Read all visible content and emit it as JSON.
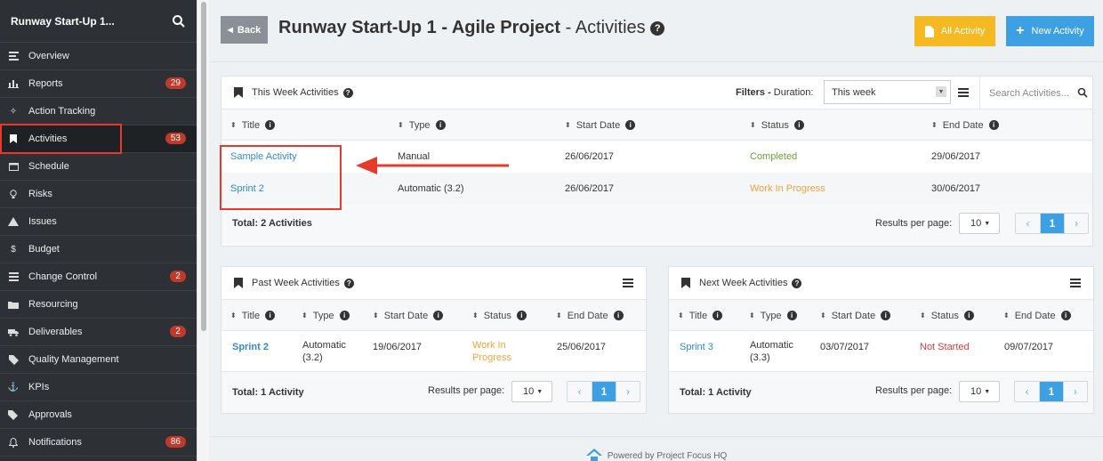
{
  "sidebar": {
    "project_name": "Runway Start-Up 1...",
    "items": [
      {
        "label": "Overview",
        "icon": "overview-icon"
      },
      {
        "label": "Reports",
        "icon": "chart-icon",
        "badge": "29"
      },
      {
        "label": "Action Tracking",
        "icon": "crosshair-icon"
      },
      {
        "label": "Activities",
        "icon": "bookmark-icon",
        "badge": "53"
      },
      {
        "label": "Schedule",
        "icon": "calendar-icon"
      },
      {
        "label": "Risks",
        "icon": "lightbulb-icon"
      },
      {
        "label": "Issues",
        "icon": "warning-icon"
      },
      {
        "label": "Budget",
        "icon": "dollar-icon"
      },
      {
        "label": "Change Control",
        "icon": "list-icon",
        "badge": "2"
      },
      {
        "label": "Resourcing",
        "icon": "folder-icon"
      },
      {
        "label": "Deliverables",
        "icon": "truck-icon",
        "badge": "2"
      },
      {
        "label": "Quality Management",
        "icon": "tag-icon"
      },
      {
        "label": "KPIs",
        "icon": "anchor-icon"
      },
      {
        "label": "Approvals",
        "icon": "tags-icon"
      },
      {
        "label": "Notifications",
        "icon": "bell-icon",
        "badge": "86"
      }
    ]
  },
  "header": {
    "back_label": "Back",
    "title_bold": "Runway Start-Up 1 - Agile Project",
    "title_sub": "- Activities",
    "all_activity_label": "All Activity",
    "new_activity_label": "New Activity"
  },
  "this_week": {
    "title": "This Week Activities",
    "filters_label": "Filters -",
    "duration_label": "Duration:",
    "duration_value": "This week",
    "search_placeholder": "Search Activities...",
    "columns": [
      "Title",
      "Type",
      "Start Date",
      "Status",
      "End Date"
    ],
    "rows": [
      {
        "title": "Sample Activity",
        "type": "Manual",
        "start": "26/06/2017",
        "status": "Completed",
        "end": "29/06/2017"
      },
      {
        "title": "Sprint 2",
        "type": "Automatic (3.2)",
        "start": "26/06/2017",
        "status": "Work In Progress",
        "end": "30/06/2017"
      }
    ],
    "total": "Total: 2 Activities",
    "rpp_label": "Results per page:",
    "rpp_value": "10",
    "page": "1"
  },
  "past_week": {
    "title": "Past Week Activities",
    "columns": [
      "Title",
      "Type",
      "Start Date",
      "Status",
      "End Date"
    ],
    "rows": [
      {
        "title": "Sprint 2",
        "type_line1": "Automatic",
        "type_line2": "(3.2)",
        "start": "19/06/2017",
        "status_line1": "Work In",
        "status_line2": "Progress",
        "end": "25/06/2017"
      }
    ],
    "total": "Total: 1 Activity",
    "rpp_label": "Results per page:",
    "rpp_value": "10",
    "page": "1"
  },
  "next_week": {
    "title": "Next Week Activities",
    "columns": [
      "Title",
      "Type",
      "Start Date",
      "Status",
      "End Date"
    ],
    "rows": [
      {
        "title": "Sprint 3",
        "type_line1": "Automatic",
        "type_line2": "(3.3)",
        "start": "03/07/2017",
        "status": "Not Started",
        "end": "09/07/2017"
      }
    ],
    "total": "Total: 1 Activity",
    "rpp_label": "Results per page:",
    "rpp_value": "10",
    "page": "1"
  },
  "footer": {
    "text": "Powered by Project Focus HQ"
  },
  "colors": {
    "sidebar_bg": "#2d3136",
    "accent_blue": "#3da0e3",
    "accent_yellow": "#f5b921",
    "badge_red": "#c0392b",
    "highlight_red": "#e8392d"
  }
}
